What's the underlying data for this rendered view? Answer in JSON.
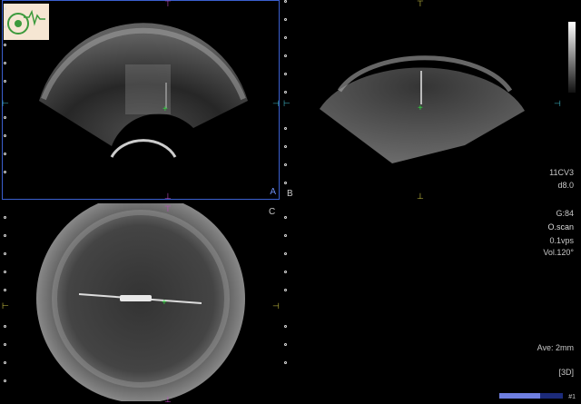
{
  "panes": {
    "a": {
      "label": "A"
    },
    "b": {
      "label": "B"
    },
    "c": {
      "label": "C"
    }
  },
  "readouts": {
    "probe": "11CV3",
    "depth": "d8.0",
    "gain": "G:84",
    "scan_mode": "O.scan",
    "volume_rate": "0.1vps",
    "volume_angle": "Vol.120°",
    "average": "Ave: 2mm",
    "mode": "[3D]",
    "page_marker": "#1"
  },
  "progress": {
    "fraction": 0.64
  },
  "colors": {
    "frame": "#3a5fcf",
    "magenta": "#c04ac0",
    "yellow": "#c8c043",
    "cyan": "#3fb8c8",
    "green": "#2fd63f"
  },
  "icons": [
    "logo-icon",
    "grayscale-bar-icon"
  ]
}
